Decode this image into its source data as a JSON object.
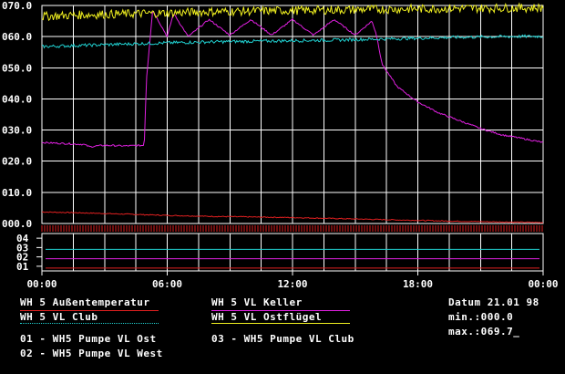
{
  "colors": {
    "background": "#000000",
    "grid": "#ffffff",
    "text": "#ffffff",
    "aussen": "#e02020",
    "keller": "#e020e0",
    "club": "#20d0d0",
    "ostfluegel": "#f0f020",
    "pump1": "#e02020",
    "pump2": "#e020e0",
    "pump3": "#20d0d0"
  },
  "chart_data": [
    {
      "type": "line",
      "title": "",
      "xlabel": "",
      "ylabel": "",
      "x_unit": "hours",
      "xlim": [
        0,
        24
      ],
      "ylim": [
        0,
        70
      ],
      "grid": true,
      "x_tick_labels": [
        "00:00",
        "06:00",
        "12:00",
        "18:00",
        "00:00"
      ],
      "y_tick_labels": [
        "000.0",
        "010.0",
        "020.0",
        "030.0",
        "040.0",
        "050.0",
        "060.0",
        "070.0"
      ],
      "series": [
        {
          "name": "WH 5 Außentemperatur",
          "color_key": "aussen",
          "x": [
            0,
            2,
            4,
            6,
            8,
            10,
            12,
            14,
            16,
            18,
            20,
            22,
            24
          ],
          "y": [
            3.7,
            3.4,
            3.0,
            2.6,
            2.3,
            2.1,
            1.9,
            1.6,
            1.3,
            1.0,
            0.7,
            0.5,
            0.3
          ]
        },
        {
          "name": "WH 5 VL Keller",
          "color_key": "keller",
          "x": [
            0,
            1,
            2,
            2.3,
            2.6,
            3,
            4,
            4.9,
            5.0,
            5.3,
            6.0,
            6.3,
            7,
            8,
            9,
            10,
            11,
            12,
            13,
            14,
            15,
            15.8,
            16.0,
            16.3,
            17,
            18,
            19,
            20,
            21,
            22,
            23,
            24
          ],
          "y": [
            26.0,
            25.7,
            25.4,
            24.6,
            24.9,
            25.1,
            24.9,
            25.1,
            46.0,
            68.5,
            60.0,
            67.5,
            60.0,
            65.5,
            60.5,
            65.5,
            60.5,
            65.5,
            60.5,
            65.5,
            60.5,
            65.0,
            61.0,
            51.0,
            44.0,
            39.0,
            35.5,
            33.0,
            30.5,
            28.5,
            27.3,
            26.0
          ]
        },
        {
          "name": "WH 5 VL Club",
          "color_key": "club",
          "x": [
            0,
            2,
            4,
            6,
            8,
            10,
            12,
            14,
            16,
            18,
            20,
            22,
            24
          ],
          "y": [
            56.8,
            57.2,
            57.6,
            58.0,
            58.3,
            58.5,
            58.7,
            58.9,
            59.2,
            59.5,
            59.8,
            60.0,
            60.1
          ]
        },
        {
          "name": "WH 5 VL Ostflügel",
          "color_key": "ostfluegel",
          "x": [
            0,
            2,
            4,
            6,
            8,
            10,
            12,
            14,
            16,
            18,
            20,
            22,
            24
          ],
          "y": [
            66.5,
            67.0,
            67.3,
            67.6,
            68.0,
            68.2,
            68.4,
            68.6,
            68.8,
            68.9,
            69.1,
            69.2,
            69.3
          ]
        }
      ]
    },
    {
      "type": "line",
      "title": "",
      "y_tick_labels": [
        "04",
        "03",
        "02",
        "01"
      ],
      "series": [
        {
          "name": "01 - WH5 Pumpe VL Ost",
          "color_key": "pump1",
          "state": 1
        },
        {
          "name": "02 - WH5 Pumpe VL West",
          "color_key": "pump2",
          "state": 1
        },
        {
          "name": "03 - WH5 Pumpe VL Club",
          "color_key": "pump3",
          "state": 1
        }
      ]
    }
  ],
  "legend": {
    "aussen": "WH 5 Außentemperatur",
    "keller": "WH 5 VL Keller",
    "club": "WH 5 VL Club",
    "ostfluegel": "WH 5 VL Ostflügel",
    "pump1": "01 - WH5 Pumpe VL Ost",
    "pump2": "02 - WH5 Pumpe VL West",
    "pump3": "03 - WH5 Pumpe VL Club"
  },
  "info": {
    "datum": "Datum 21.01 98",
    "min": "min.:000.0",
    "max": "max.:069.7_"
  }
}
